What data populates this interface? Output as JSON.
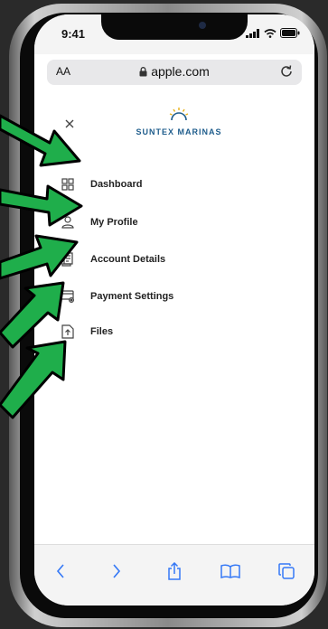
{
  "status": {
    "time": "9:41"
  },
  "browser": {
    "text_size_label": "AA",
    "domain": "apple.com"
  },
  "logo": {
    "text": "SUNTEX MARINAS"
  },
  "menu": [
    {
      "label": "Dashboard",
      "icon": "dashboard-icon"
    },
    {
      "label": "My Profile",
      "icon": "profile-icon"
    },
    {
      "label": "Account Details",
      "icon": "receipt-icon"
    },
    {
      "label": "Payment Settings",
      "icon": "payment-card-icon"
    },
    {
      "label": "Files",
      "icon": "file-upload-icon"
    }
  ],
  "toolbar": [
    "back-icon",
    "forward-icon",
    "share-icon",
    "bookmarks-icon",
    "tabs-icon"
  ],
  "colors": {
    "arrow_fill": "#1fae4b",
    "arrow_outline": "#000000",
    "brand_blue": "#1f5d8c",
    "brand_gold": "#e8b21a"
  }
}
